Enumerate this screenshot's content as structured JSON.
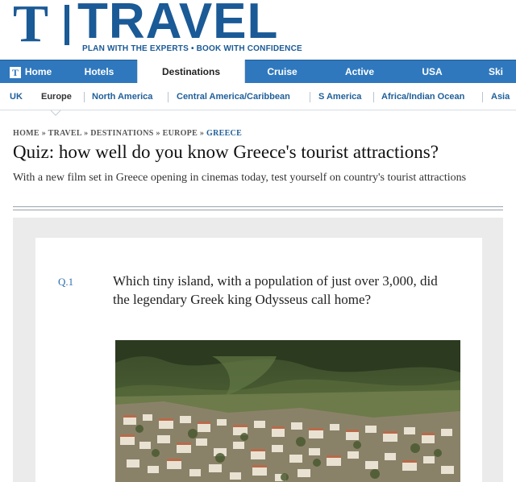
{
  "masthead": {
    "logo_letter": "T",
    "wordmark": "TRAVEL",
    "tagline": "PLAN WITH THE EXPERTS • BOOK WITH CONFIDENCE",
    "brand_color": "#1a5a96"
  },
  "main_nav": {
    "items": [
      {
        "label": "Home",
        "icon": "telegraph-t-icon"
      },
      {
        "label": "Hotels"
      },
      {
        "label": "Destinations",
        "active": true
      },
      {
        "label": "Cruise"
      },
      {
        "label": "Active"
      },
      {
        "label": "USA"
      },
      {
        "label": "Ski"
      }
    ],
    "color": "#2f78bd"
  },
  "sub_nav": {
    "items": [
      "UK",
      "Europe",
      "North America",
      "Central America/Caribbean",
      "S America",
      "Africa/Indian Ocean",
      "Asia"
    ],
    "current": "Europe"
  },
  "breadcrumb": [
    "HOME",
    "TRAVEL",
    "DESTINATIONS",
    "EUROPE",
    "GREECE"
  ],
  "breadcrumb_separator": "»",
  "article": {
    "headline": "Quiz: how well do you know Greece's tourist attractions?",
    "standfirst": "With a new film set in Greece opening in cinemas today, test yourself on country's tourist attractions"
  },
  "quiz": {
    "question_number": "Q.1",
    "question_text": "Which tiny island, with a population of just over 3,000, did the legendary Greek king Odysseus call home?"
  }
}
